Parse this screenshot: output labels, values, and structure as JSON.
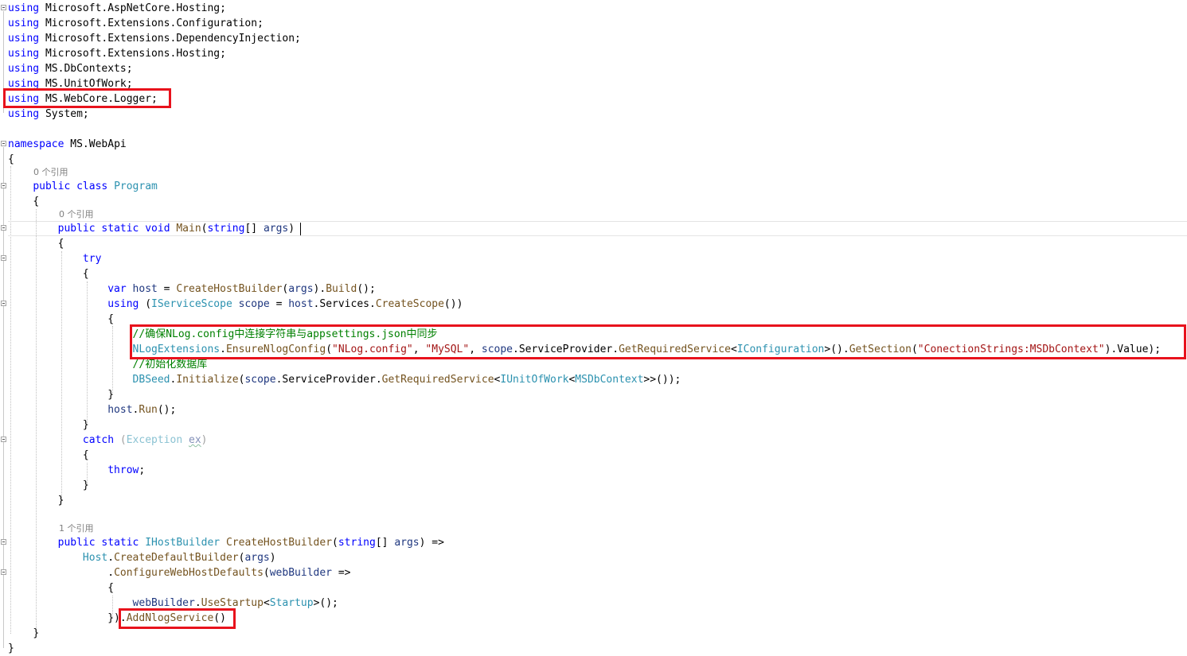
{
  "colors": {
    "keyword": "#0000ff",
    "type": "#2b91af",
    "method": "#74531f",
    "string": "#a31515",
    "comment": "#008000",
    "highlight_box": "#e8121c"
  },
  "icons": [
    "fold-toggle-icon"
  ],
  "code": {
    "l1": {
      "kw": "using",
      "rest": " Microsoft.AspNetCore.Hosting;"
    },
    "l2": {
      "kw": "using",
      "rest": " Microsoft.Extensions.Configuration;"
    },
    "l3": {
      "kw": "using",
      "rest": " Microsoft.Extensions.DependencyInjection;"
    },
    "l4": {
      "kw": "using",
      "rest": " Microsoft.Extensions.Hosting;"
    },
    "l5": {
      "kw": "using",
      "rest": " MS.DbContexts;"
    },
    "l6": {
      "kw": "using",
      "rest": " MS.UnitOfWork;"
    },
    "l7": {
      "kw": "using",
      "rest": " MS.WebCore.Logger;"
    },
    "l8": {
      "kw": "using",
      "rest": " System;"
    },
    "l10": {
      "kw": "namespace",
      "rest": " MS.WebApi"
    },
    "brace_open": "{",
    "brace_close": "}",
    "lens_class": "0 个引用",
    "l13": {
      "kw1": "public",
      "kw2": "class",
      "name": "Program"
    },
    "lens_main": "0 个引用",
    "l16": {
      "kw1": "public",
      "kw2": "static",
      "kw3": "void",
      "name": "Main",
      "p1": "(",
      "ptype": "string",
      "p2": "[] ",
      "pname": "args",
      "p3": ")"
    },
    "l18": {
      "kw": "try"
    },
    "l20": {
      "kw": "var",
      "sp": " ",
      "lv": "host",
      "eq": " = ",
      "m1": "CreateHostBuilder",
      "p1": "(",
      "arg": "args",
      "p2": ").",
      "m2": "Build",
      "p3": "();"
    },
    "l21": {
      "kw": "using",
      "p1": " (",
      "ty": "IServiceScope",
      "sp": " ",
      "lv": "scope",
      "eq": " = ",
      "lv2": "host",
      "dot": ".",
      "prop": "Services",
      "dot2": ".",
      "m": "CreateScope",
      "p2": "())"
    },
    "l23": {
      "comment": "//确保NLog.config中连接字符串与appsettings.json中同步"
    },
    "l24": {
      "ty": "NLogExtensions",
      "d1": ".",
      "m1": "EnsureNlogConfig",
      "p1": "(",
      "s1": "\"NLog.config\"",
      "c1": ", ",
      "s2": "\"MySQL\"",
      "c2": ", ",
      "lv": "scope",
      "d2": ".",
      "prop": "ServiceProvider",
      "d3": ".",
      "m2": "GetRequiredService",
      "lt": "<",
      "ty2": "IConfiguration",
      "gt": ">().",
      "m3": "GetSection",
      "p2": "(",
      "s3": "\"ConectionStrings:MSDbContext\"",
      "p3": ").Value);"
    },
    "l25": {
      "comment": "//初始化数据库"
    },
    "l26": {
      "ty": "DBSeed",
      "d1": ".",
      "m1": "Initialize",
      "p1": "(",
      "lv": "scope",
      "d2": ".",
      "prop": "ServiceProvider",
      "d3": ".",
      "m2": "GetRequiredService",
      "lt": "<",
      "ty2": "IUnitOfWork",
      "lt2": "<",
      "ty3": "MSDbContext",
      "p2": ">>());"
    },
    "l28": {
      "lv": "host",
      "d": ".",
      "m": "Run",
      "p": "();"
    },
    "l30": {
      "kw": "catch",
      "p1": " (",
      "ty": "Exception",
      "sp": " ",
      "lv": "ex",
      "p2": ")"
    },
    "l32": {
      "kw": "throw",
      "p": ";"
    },
    "lens_builder": "1 个引用",
    "l36": {
      "kw1": "public",
      "kw2": "static",
      "ty": "IHostBuilder",
      "name": "CreateHostBuilder",
      "p1": "(",
      "ptype": "string",
      "p2": "[] ",
      "pname": "args",
      "p3": ") =>"
    },
    "l37": {
      "ty": "Host",
      "d": ".",
      "m": "CreateDefaultBuilder",
      "p1": "(",
      "arg": "args",
      "p2": ")"
    },
    "l38": {
      "d": ".",
      "m": "ConfigureWebHostDefaults",
      "p1": "(",
      "pname": "webBuilder",
      "p2": " =>"
    },
    "l40": {
      "pname": "webBuilder",
      "d": ".",
      "m": "UseStartup",
      "lt": "<",
      "ty": "Startup",
      "p": ">();"
    },
    "l41": {
      "close": "})",
      "d": ".",
      "m": "AddNlogService",
      "p": "()"
    }
  }
}
